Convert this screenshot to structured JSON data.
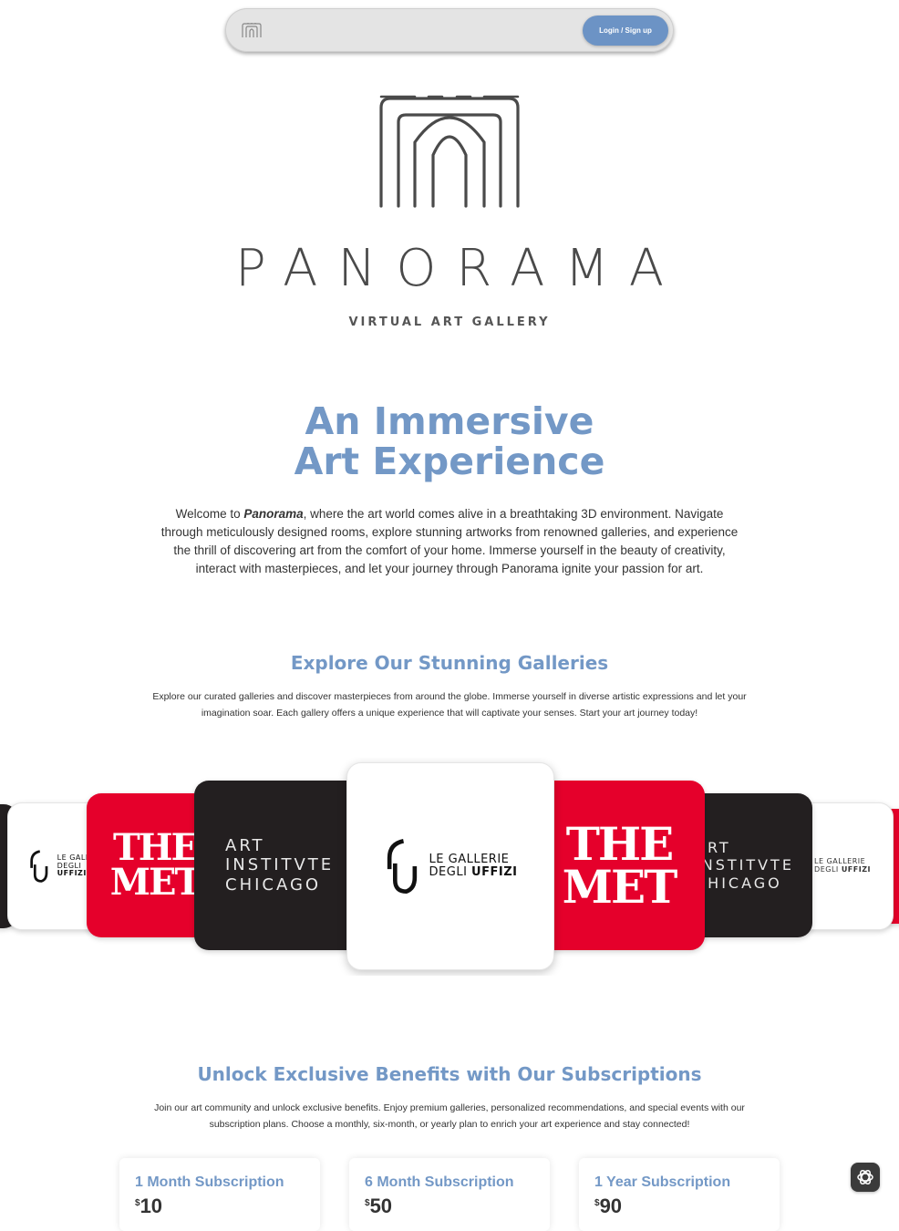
{
  "nav": {
    "logo_icon": "panorama-arch-icon",
    "login_label": "Login / Sign up"
  },
  "hero": {
    "brand_name": "PANORAMA",
    "brand_subtitle": "VIRTUAL ART GALLERY",
    "title_line1": "An Immersive",
    "title_line2": "Art Experience",
    "intro_prefix": "Welcome to ",
    "intro_brand": "Panorama",
    "intro_rest": ", where the art world comes alive in a breathtaking 3D environment. Navigate through meticulously designed rooms, explore stunning artworks from renowned galleries, and experience the thrill of discovering art from the comfort of your home. Immerse yourself in the beauty of creativity, interact with masterpieces, and let your journey through Panorama ignite your passion for art."
  },
  "galleries": {
    "title": "Explore Our Stunning Galleries",
    "description": "Explore our curated galleries and discover masterpieces from around the globe. Immerse yourself in diverse artistic expressions and let your imagination soar. Each gallery offers a unique experience that will captivate your senses. Start your art journey today!",
    "met_line1": "THE",
    "met_line2": "MET",
    "aic_line1": "ART",
    "aic_line2": "INSTITVTE",
    "aic_line3": "CHICAGO",
    "uffizi_line1": "LE GALLERIE",
    "uffizi_line2_a": "DEGLI ",
    "uffizi_line2_b": "UFFIZI",
    "colors": {
      "met_red": "#e5002b",
      "aic_dark": "#231f20",
      "white": "#ffffff"
    }
  },
  "subscriptions": {
    "title": "Unlock Exclusive Benefits with Our Subscriptions",
    "description": "Join our art community and unlock exclusive benefits. Enjoy premium galleries, personalized recommendations, and special events with our subscription plans. Choose a monthly, six-month, or yearly plan to enrich your art experience and stay connected!",
    "plans": [
      {
        "name": "1 Month Subscription",
        "currency": "$",
        "price": "10"
      },
      {
        "name": "6 Month Subscription",
        "currency": "$",
        "price": "50"
      },
      {
        "name": "1 Year Subscription",
        "currency": "$",
        "price": "90"
      }
    ]
  },
  "widgets": {
    "chat_icon": "chatgpt-icon"
  },
  "theme": {
    "accent": "#7398c6",
    "button": "#6c93c5"
  }
}
